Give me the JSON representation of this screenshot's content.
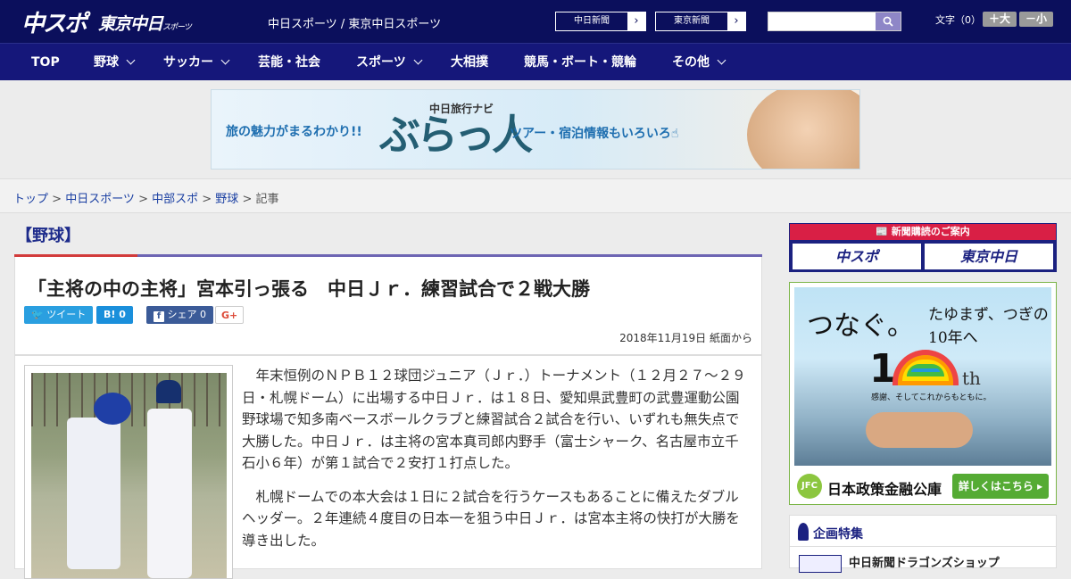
{
  "header": {
    "logo_main": "中スポ",
    "logo_tokyo": "東京中日",
    "logo_tokyo_small": "スポーツ",
    "site_name": "中日スポーツ / 東京中日スポーツ",
    "btn_chunichi": "中日新聞",
    "btn_tokyo": "東京新聞",
    "search_placeholder": "",
    "font_size_label": "文字（0）",
    "font_larger": "＋大",
    "font_smaller": "－小"
  },
  "nav": {
    "items": [
      {
        "label": "TOP"
      },
      {
        "label": "野球"
      },
      {
        "label": "サッカー"
      },
      {
        "label": "芸能・社会"
      },
      {
        "label": "スポーツ"
      },
      {
        "label": "大相撲"
      },
      {
        "label": "競馬・ボート・競輪"
      },
      {
        "label": "その他"
      }
    ]
  },
  "banner": {
    "left_text": "旅の魅力がまるわかり!!",
    "name_small": "中日旅行ナビ",
    "name_big": "ぶらっ人",
    "right_text": "ツアー・宿泊情報もいろいろ☝"
  },
  "breadcrumb": {
    "items": [
      "トップ",
      "中日スポーツ",
      "中部スポ",
      "野球"
    ],
    "current": "記事",
    "sep": " > "
  },
  "article": {
    "category": "【野球】",
    "headline": "「主将の中の主将」宮本引っ張る　中日Ｊｒ．練習試合で２戦大勝",
    "share_tweet": "ツイート",
    "share_hatena_label": "B!",
    "share_hatena_count": "0",
    "share_fb_label": "シェア",
    "share_fb_count": "0",
    "share_gplus": "G+",
    "date": "2018年11月19日 紙面から",
    "paragraphs": [
      "年末恒例のＮＰＢ１２球団ジュニア（Ｊｒ．）トーナメント（１２月２７～２９日・札幌ドーム）に出場する中日Ｊｒ．は１８日、愛知県武豊町の武豊運動公園野球場で知多南ベースボールクラブと練習試合２試合を行い、いずれも無失点で大勝した。中日Ｊｒ．は主将の宮本真司郎内野手（富士シャーク、名古屋市立千石小６年）が第１試合で２安打１打点した。",
      "札幌ドームでの本大会は１日に２試合を行うケースもあることに備えたダブルヘッダー。２年連続４度目の日本一を狙う中日Ｊｒ．は宮本主将の快打が大勝を導き出した。"
    ]
  },
  "sidebar": {
    "subscribe_header": "新聞購読のご案内",
    "subscribe_btn1": "中スポ",
    "subscribe_btn2": "東京中日",
    "ad_title1": "つなぐ。",
    "ad_title2": "たゆまず、つぎの10年へ",
    "ad_ten": "1",
    "ad_th": "th",
    "ad_caption": "感謝、そしてこれからもともに。",
    "ad_jfc": "JFC",
    "ad_org": "日本政策金融公庫",
    "ad_button": "詳しくはこちら ▸",
    "feature_heading": "企画特集",
    "feature_item": "中日新聞ドラゴンズショップ"
  }
}
